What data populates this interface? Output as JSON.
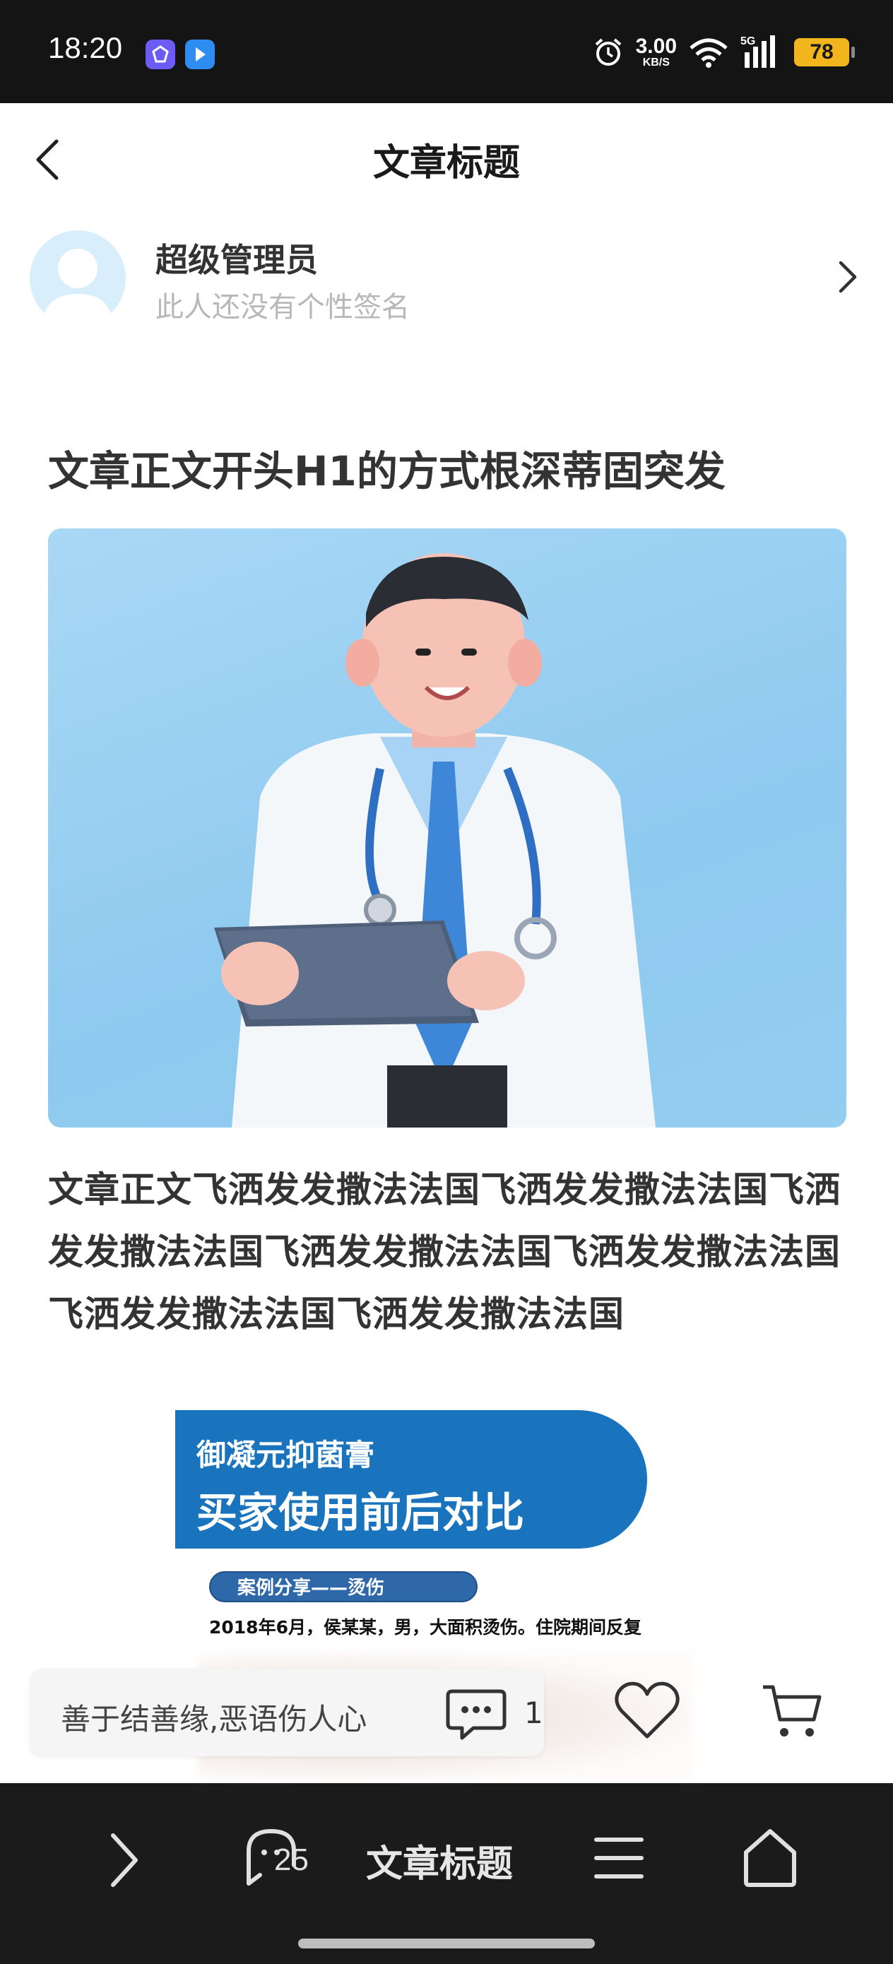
{
  "status_bar": {
    "time": "18:20",
    "net_speed_value": "3.00",
    "net_speed_unit": "KB/S",
    "network": "5G",
    "battery": "78"
  },
  "nav": {
    "title": "文章标题"
  },
  "author": {
    "name": "超级管理员",
    "signature": "此人还没有个性签名"
  },
  "article": {
    "headline": "文章正文开头H1的方式根深蒂固突发",
    "body": "文章正文飞洒发发撒法法国飞洒发发撒法法国飞洒发发撒法法国飞洒发发撒法法国飞洒发发撒法法国飞洒发发撒法法国飞洒发发撒法法国",
    "promo": {
      "subtitle": "御凝元抑菌膏",
      "title": "买家使用前后对比",
      "case_label": "案例分享——烫伤",
      "case_text": "2018年6月，侯某某，男，大面积烫伤。住院期间反复"
    }
  },
  "actions": {
    "comment_placeholder": "善于结善缘,恶语伤人心",
    "comment_count": "1"
  },
  "toolbar": {
    "title": "文章标题",
    "comments_badge": "25"
  },
  "colors": {
    "status_bar_bg": "#141414",
    "toolbar_bg": "#1b1b1b",
    "promo_blue": "#1a74bd",
    "battery": "#f2b51d"
  }
}
